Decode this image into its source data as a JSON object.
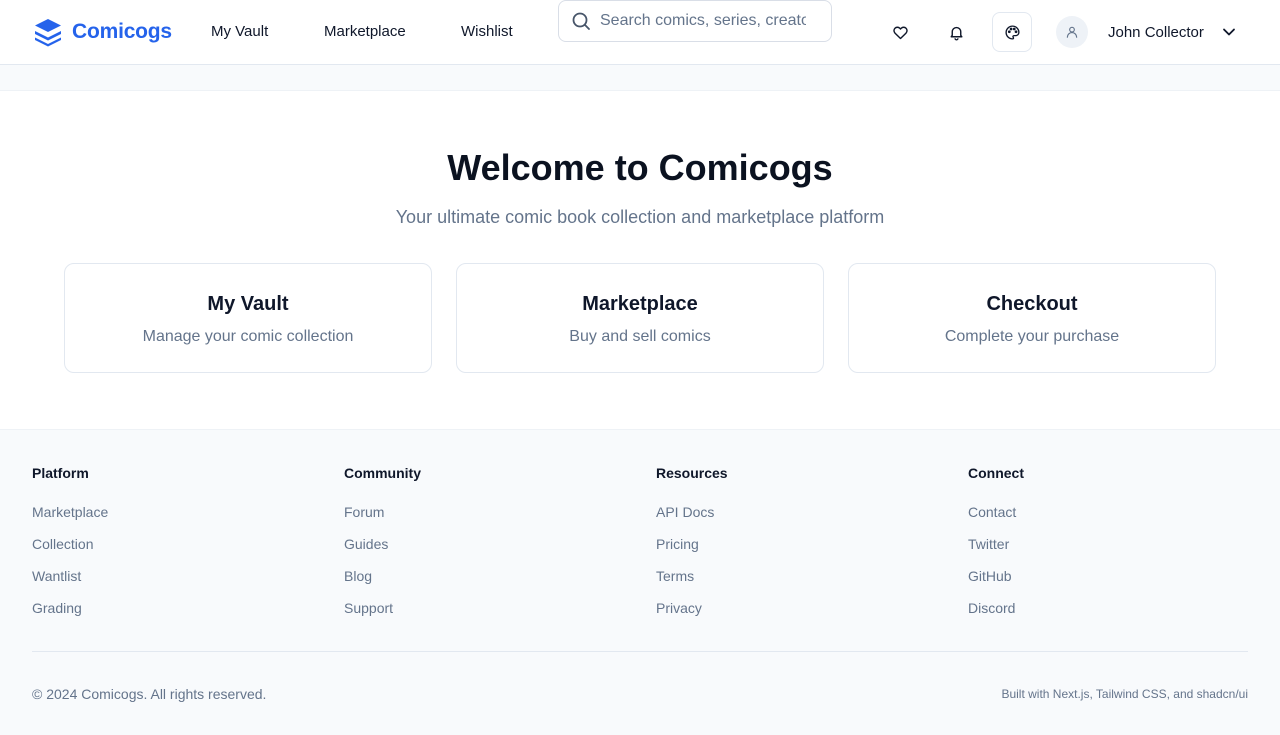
{
  "header": {
    "brand": "Comicogs",
    "nav": [
      "My Vault",
      "Marketplace",
      "Wishlist"
    ],
    "search_placeholder": "Search comics, series, creators...",
    "icons": [
      "heart-icon",
      "bell-icon",
      "palette-icon",
      "user-icon",
      "chevron-down-icon"
    ],
    "user_name": "John Collector",
    "brand_color": "#2563eb"
  },
  "hero": {
    "title": "Welcome to Comicogs",
    "subtitle": "Your ultimate comic book collection and marketplace platform"
  },
  "cards": [
    {
      "title": "My Vault",
      "description": "Manage your comic collection"
    },
    {
      "title": "Marketplace",
      "description": "Buy and sell comics"
    },
    {
      "title": "Checkout",
      "description": "Complete your purchase"
    }
  ],
  "footer": {
    "columns": [
      {
        "title": "Platform",
        "links": [
          "Marketplace",
          "Collection",
          "Wantlist",
          "Grading"
        ]
      },
      {
        "title": "Community",
        "links": [
          "Forum",
          "Guides",
          "Blog",
          "Support"
        ]
      },
      {
        "title": "Resources",
        "links": [
          "API Docs",
          "Pricing",
          "Terms",
          "Privacy"
        ]
      },
      {
        "title": "Connect",
        "links": [
          "Contact",
          "Twitter",
          "GitHub",
          "Discord"
        ]
      }
    ],
    "copyright": "© 2024 Comicogs. All rights reserved.",
    "built_with": "Built with Next.js, Tailwind CSS, and shadcn/ui"
  }
}
